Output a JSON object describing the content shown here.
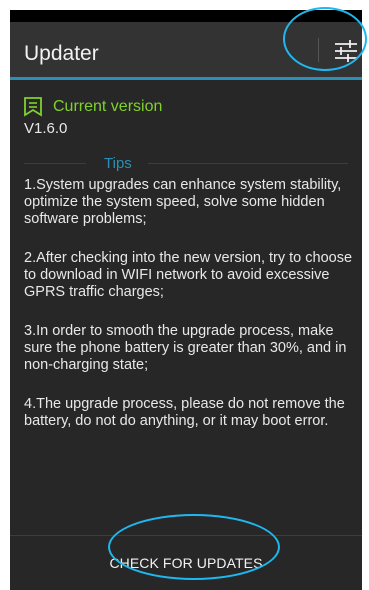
{
  "app": {
    "title": "Updater"
  },
  "icons": {
    "settings": "sliders-icon",
    "version": "flag-icon"
  },
  "current_version": {
    "label": "Current version",
    "value": "V1.6.0"
  },
  "tips": {
    "heading": "Tips",
    "items": [
      "1.System upgrades can enhance system stability, optimize the system speed, solve some hidden software problems;",
      "2.After checking into the new version, try to choose to download in WIFI network to avoid excessive GPRS traffic charges;",
      "3.In order to smooth the upgrade process, make sure the phone battery is greater than 30%, and in non-charging state;",
      "4.The upgrade process, please do not remove the battery, do not do anything, or it may boot error."
    ]
  },
  "actions": {
    "check_updates": "CHECK FOR UPDATES"
  },
  "colors": {
    "accent": "#2b8fb7",
    "version_green": "#7fd12c",
    "annotation": "#1fb8ee"
  }
}
